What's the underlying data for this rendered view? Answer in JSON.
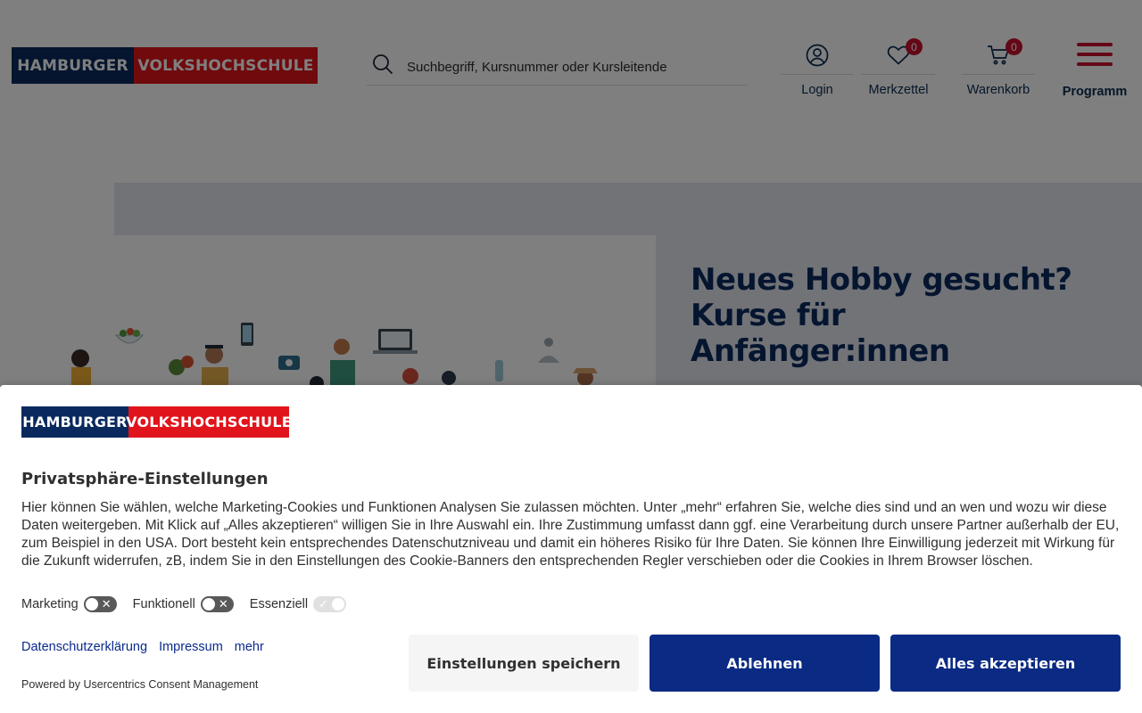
{
  "header": {
    "logo": {
      "part1": "HAMBURGER",
      "part2": "VOLKSHOCHSCHULE"
    },
    "search": {
      "placeholder": "Suchbegriff, Kursnummer oder Kursleitende"
    },
    "login": {
      "label": "Login"
    },
    "wishlist": {
      "label": "Merkzettel",
      "count": "0"
    },
    "cart": {
      "label": "Warenkorb",
      "count": "0"
    },
    "menu": {
      "label": "Programm"
    }
  },
  "hero": {
    "title": "Neues Hobby gesucht? Kurse für Anfänger:innen"
  },
  "consent": {
    "logo": {
      "part1": "HAMBURGER",
      "part2": "VOLKSHOCHSCHULE"
    },
    "title": "Privatsphäre-Einstellungen",
    "text": "Hier können Sie wählen, welche Marketing-Cookies und Funktionen Analysen Sie zulassen möchten. Unter „mehr“ erfahren Sie, welche dies sind und an wen und wozu wir diese Daten weitergeben. Mit Klick auf „Alles akzeptieren“ willigen Sie in Ihre Auswahl ein. Ihre Zustimmung umfasst dann ggf. eine Verarbeitung durch unsere Partner außerhalb der EU, zum Beispiel in den USA. Dort besteht kein entsprechendes Datenschutzniveau und damit ein höheres Risiko für Ihre Daten. Sie können Ihre Einwilligung jederzeit mit Wirkung für die Zukunft widerrufen, zB, indem Sie in den Einstellungen des Cookie-Banners den entsprechenden Regler verschieben oder die Cookies in Ihrem Browser löschen.",
    "toggles": [
      {
        "label": "Marketing",
        "state": "off"
      },
      {
        "label": "Funktionell",
        "state": "off"
      },
      {
        "label": "Essenziell",
        "state": "on-locked"
      }
    ],
    "links": {
      "privacy": "Datenschutzerklärung",
      "imprint": "Impressum",
      "more": "mehr"
    },
    "powered_by": "Powered by Usercentrics Consent Management",
    "buttons": {
      "save": "Einstellungen speichern",
      "deny": "Ablehnen",
      "accept": "Alles akzeptieren"
    }
  },
  "colors": {
    "brand_blue": "#0a2a5e",
    "brand_red": "#e1141b",
    "button_blue": "#0a2a84",
    "badge_red": "#c8102e"
  }
}
